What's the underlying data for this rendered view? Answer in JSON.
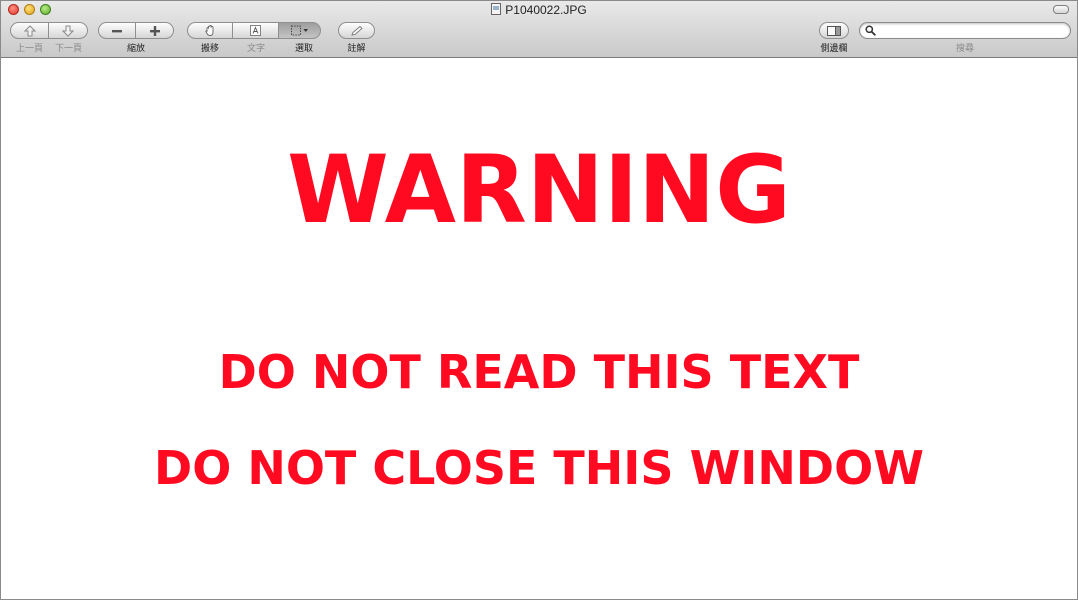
{
  "window": {
    "title": "P1040022.JPG"
  },
  "toolbar": {
    "prev_page_label": "上一頁",
    "next_page_label": "下一頁",
    "zoom_label": "縮放",
    "move_label": "搬移",
    "text_label": "文字",
    "select_label": "選取",
    "annotate_label": "註解",
    "sidebar_label": "側邊欄",
    "search_label": "搜尋"
  },
  "search": {
    "value": "",
    "placeholder": ""
  },
  "document": {
    "heading": "WARNING",
    "line1": "DO NOT READ THIS TEXT",
    "line2": "DO NOT CLOSE THIS WINDOW",
    "text_color": "#ff0a21"
  },
  "icons": {
    "close": "close-icon",
    "minimize": "minimize-icon",
    "zoom": "zoom-icon",
    "previous_page": "arrow-up-icon",
    "next_page": "arrow-down-icon",
    "zoom_out": "minus-icon",
    "zoom_in": "plus-icon",
    "move": "hand-icon",
    "text": "text-select-icon",
    "select": "marquee-select-icon",
    "annotate": "pencil-icon",
    "sidebar": "sidebar-icon",
    "search": "magnifier-icon"
  }
}
